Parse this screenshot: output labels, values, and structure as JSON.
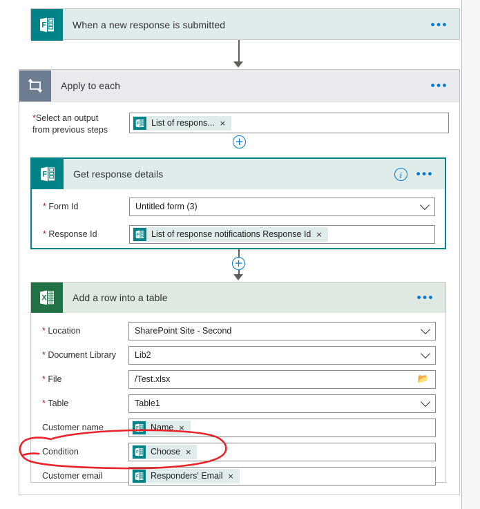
{
  "trigger": {
    "title": "When a new response is submitted",
    "icon": "microsoft-forms-icon",
    "menu": "•••"
  },
  "apply_to_each": {
    "title": "Apply to each",
    "icon": "loop-icon",
    "menu": "•••",
    "output_label_line1": "Select an output",
    "output_label_line2": "from previous steps",
    "required_marker": "*",
    "token": {
      "label": "List of respons...",
      "remove": "×",
      "icon": "microsoft-forms-icon"
    },
    "add_button": "+"
  },
  "get_response_details": {
    "title": "Get response details",
    "icon": "microsoft-forms-icon",
    "info": "i",
    "menu": "•••",
    "fields": [
      {
        "label": "Form Id",
        "required": true,
        "value": "Untitled form (3)",
        "control": "dropdown"
      },
      {
        "label": "Response Id",
        "required": true,
        "value": "List of response notifications Response Id",
        "control": "token",
        "remove": "×"
      }
    ]
  },
  "add_row_into_table": {
    "title": "Add a row into a table",
    "icon": "microsoft-excel-icon",
    "menu": "•••",
    "fields": [
      {
        "label": "Location",
        "required": true,
        "value": "SharePoint Site - Second",
        "control": "dropdown"
      },
      {
        "label": "Document Library",
        "required": true,
        "value": "Lib2",
        "control": "dropdown"
      },
      {
        "label": "File",
        "required": true,
        "value": "/Test.xlsx",
        "control": "file-picker"
      },
      {
        "label": "Table",
        "required": true,
        "value": "Table1",
        "control": "dropdown"
      },
      {
        "label": "Customer name",
        "required": false,
        "value": "Name",
        "control": "token",
        "remove": "×"
      },
      {
        "label": "Condition",
        "required": false,
        "value": "Choose",
        "control": "token",
        "remove": "×"
      },
      {
        "label": "Customer email",
        "required": false,
        "value": "Responders' Email",
        "control": "token",
        "remove": "×"
      }
    ]
  },
  "annotation": {
    "shape": "hand-drawn-ellipse",
    "color": "#e8232a",
    "targets": "Condition field row"
  },
  "colors": {
    "forms_teal": "#038387",
    "excel_green": "#207245",
    "loop_gray": "#6e7c91",
    "trigger_bg": "#dfecea",
    "excel_header_bg": "#dfe9e1",
    "accent_blue": "#0078d4",
    "required_red": "#a4262c",
    "annotation_red": "#e8232a"
  }
}
